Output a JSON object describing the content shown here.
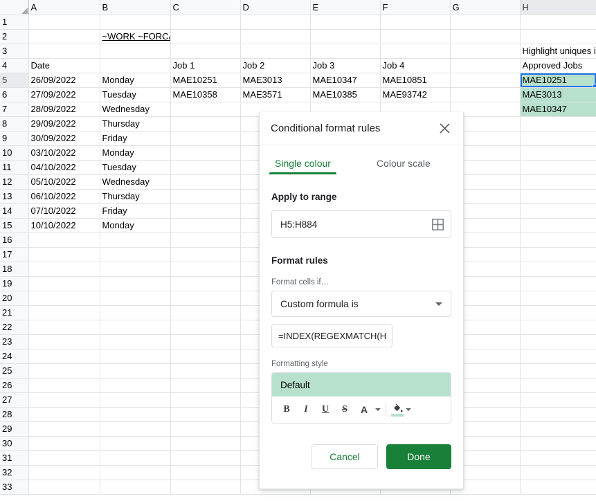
{
  "spreadsheet": {
    "column_headers": [
      "A",
      "B",
      "C",
      "D",
      "E",
      "F",
      "G",
      "H"
    ],
    "active_column": "H",
    "active_row": 5,
    "selected_cell": "H5",
    "row_count": 33,
    "cells": {
      "B2": "~WORK ~FORCAST",
      "A4": "Date",
      "C4": "Job 1",
      "D4": "Job 2",
      "E4": "Job 3",
      "F4": "Job 4",
      "H3": "Highlight uniques i",
      "H4": "Approved Jobs",
      "A5": "26/09/2022",
      "B5": "Monday",
      "C5": "MAE10251",
      "D5": "MAE3013",
      "E5": "MAE10347",
      "F5": "MAE10851",
      "H5": "MAE10251",
      "A6": "27/09/2022",
      "B6": "Tuesday",
      "C6": "MAE10358",
      "D6": "MAE3571",
      "E6": "MAE10385",
      "F6": "MAE93742",
      "H6": "MAE3013",
      "A7": "28/09/2022",
      "B7": "Wednesday",
      "H7": "MAE10347",
      "A8": "29/09/2022",
      "B8": "Thursday",
      "A9": "30/09/2022",
      "B9": "Friday",
      "A10": "03/10/2022",
      "B10": "Monday",
      "A11": "04/10/2022",
      "B11": "Tuesday",
      "A12": "05/10/2022",
      "B12": "Wednesday",
      "A13": "06/10/2022",
      "B13": "Thursday",
      "A14": "07/10/2022",
      "B14": "Friday",
      "A15": "10/10/2022",
      "B15": "Monday"
    },
    "colors": {
      "highlight_fill": "#b7e1cd",
      "note_text": "#ff0000",
      "selection_border": "#1a73e8"
    }
  },
  "dialog": {
    "title": "Conditional format rules",
    "close_icon": "close-icon",
    "tabs": [
      {
        "label": "Single colour",
        "active": true
      },
      {
        "label": "Colour scale",
        "active": false
      }
    ],
    "apply_to_range": {
      "label": "Apply to range",
      "value": "H5:H884",
      "picker_icon": "grid-picker-icon"
    },
    "format_rules": {
      "heading": "Format rules",
      "condition_label": "Format cells if…",
      "condition_value": "Custom formula is",
      "formula_value": "=INDEX(REGEXMATCH(H"
    },
    "formatting_style": {
      "label": "Formatting style",
      "preview_text": "Default",
      "preview_fill": "#b7e1cd",
      "toolbar": [
        {
          "name": "bold",
          "glyph": "B"
        },
        {
          "name": "italic",
          "glyph": "I"
        },
        {
          "name": "underline",
          "glyph": "U"
        },
        {
          "name": "strikethrough",
          "glyph": "S"
        },
        {
          "name": "text-colour",
          "glyph": "A"
        },
        {
          "name": "fill-colour",
          "glyph": "bucket"
        }
      ]
    },
    "actions": {
      "cancel_label": "Cancel",
      "done_label": "Done",
      "done_colour": "#188038"
    }
  }
}
